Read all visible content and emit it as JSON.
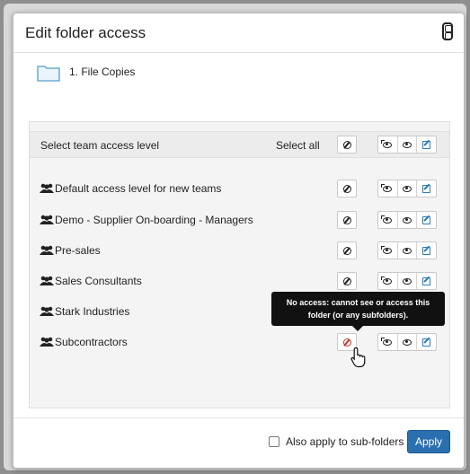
{
  "dialog": {
    "title": "Edit folder access",
    "close_icon": "close-icon"
  },
  "folder": {
    "name": "1. File Copies",
    "icon": "folder-icon"
  },
  "panel": {
    "header_label": "Select team access level",
    "select_all_label": "Select all"
  },
  "teams": [
    {
      "name": "Default access level for new teams"
    },
    {
      "name": "Demo - Supplier On-boarding - Managers"
    },
    {
      "name": "Pre-sales"
    },
    {
      "name": "Sales Consultants"
    },
    {
      "name": "Stark Industries"
    },
    {
      "name": "Subcontractors"
    }
  ],
  "tooltip": {
    "line1": "No access: cannot see or access this",
    "line2": "folder (or any subfolders)."
  },
  "footer": {
    "checkbox_label": "Also apply to sub-folders",
    "apply_label": "Apply"
  },
  "colors": {
    "accent": "#2a6fb0",
    "edit_icon": "#2a7ab8",
    "no_access_active": "#c0392b"
  }
}
